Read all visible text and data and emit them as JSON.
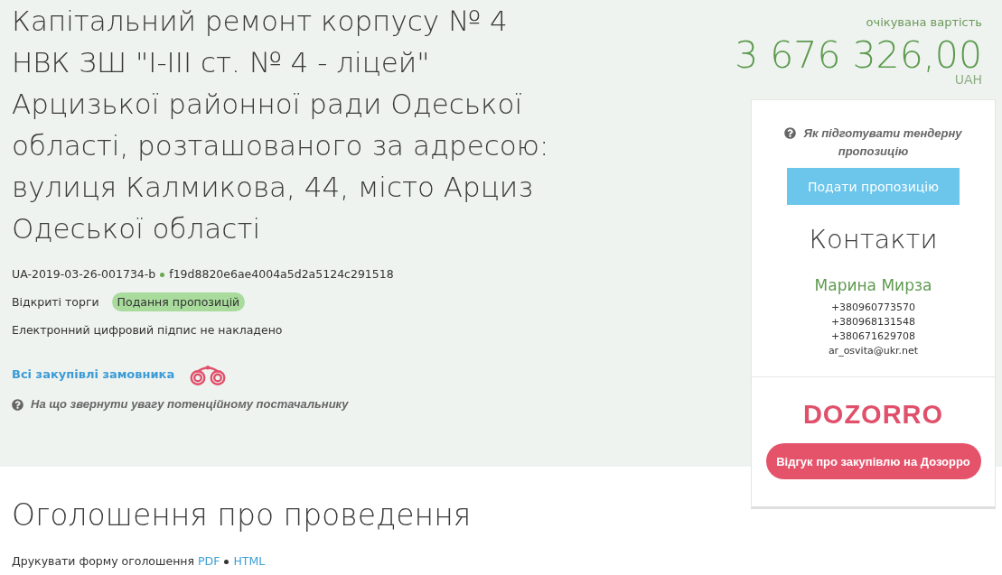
{
  "tender": {
    "title": "Капітальний ремонт корпусу № 4 НВК ЗШ \"І-ІІІ ст. № 4 - ліцей\" Арцизької районної ради Одеської області, розташованого за адресою: вулиця Калмикова, 44, місто Арциз Одеської області",
    "id": "UA-2019-03-26-001734-b",
    "hash": "f19d8820e6ae4004a5d2a5124c291518",
    "procedure": "Відкриті торги",
    "status": "Подання пропозицій",
    "signature_note": "Електронний цифровий підпис не накладено",
    "customer_link": "Всі закупівлі замовника",
    "advice_link": "На що звернути увагу потенційному постачальнику"
  },
  "budget": {
    "label": "очікувана вартість",
    "amount": "3 676 326,00",
    "currency": "UAH"
  },
  "sidebar": {
    "help_link": "Як підготувати тендерну пропозицію",
    "submit_button": "Подати пропозицію",
    "contacts": {
      "heading": "Контакти",
      "name": "Марина Мирза",
      "phones": [
        "+380960773570",
        "+380968131548",
        "+380671629708"
      ],
      "email": "ar_osvita@ukr.net"
    },
    "dozorro": {
      "logo": "DOZORRO",
      "button": "Відгук про закупівлю на Дозорро"
    }
  },
  "announcement": {
    "heading": "Оголошення про проведення",
    "print_label": "Друкувати форму оголошення",
    "links": [
      "PDF",
      "HTML"
    ]
  }
}
